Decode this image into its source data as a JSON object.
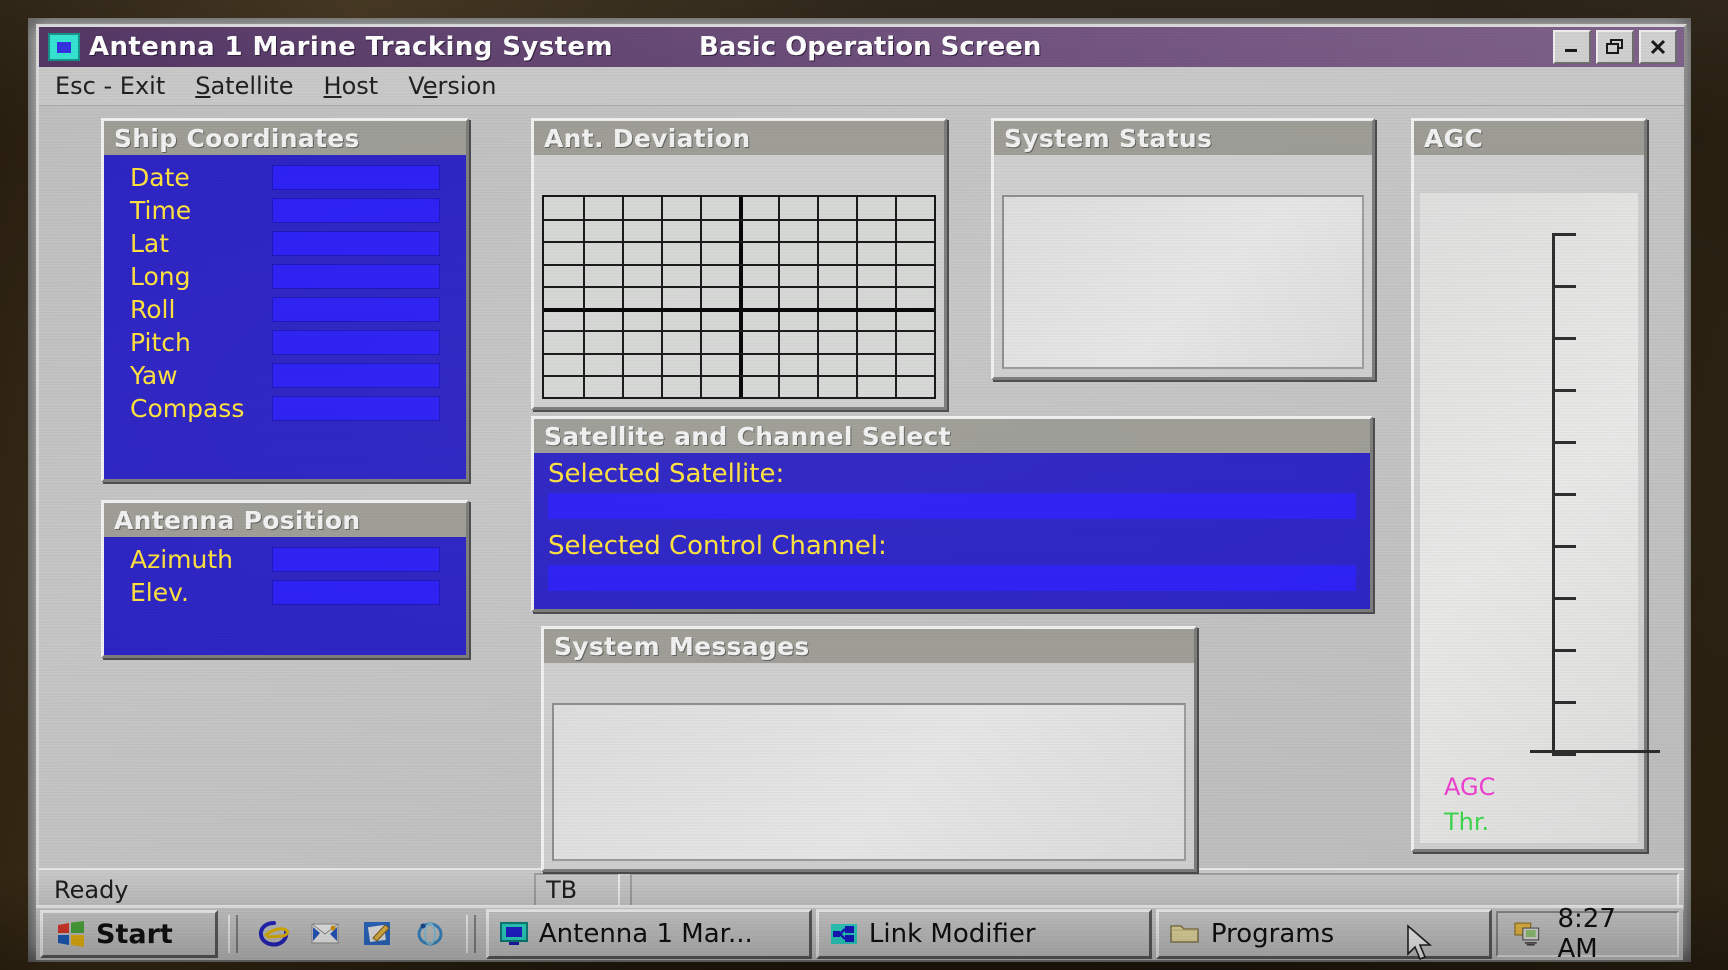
{
  "window": {
    "title": "Antenna 1 Marine Tracking System",
    "subtitle": "Basic Operation Screen",
    "icon": "monitor-icon",
    "controls": {
      "minimize": "–",
      "restore": "❐",
      "close": "✕"
    }
  },
  "menu": {
    "items": [
      {
        "label": "Esc - Exit",
        "accel": ""
      },
      {
        "label": "Satellite",
        "accel": "S"
      },
      {
        "label": "Host",
        "accel": "H"
      },
      {
        "label": "Version",
        "accel": "e"
      }
    ]
  },
  "panels": {
    "ship_coordinates": {
      "caption": "Ship Coordinates",
      "fields": [
        {
          "label": "Date",
          "value": ""
        },
        {
          "label": "Time",
          "value": ""
        },
        {
          "label": "Lat",
          "value": ""
        },
        {
          "label": "Long",
          "value": ""
        },
        {
          "label": "Roll",
          "value": ""
        },
        {
          "label": "Pitch",
          "value": ""
        },
        {
          "label": "Yaw",
          "value": ""
        },
        {
          "label": "Compass",
          "value": ""
        }
      ]
    },
    "antenna_position": {
      "caption": "Antenna Position",
      "fields": [
        {
          "label": "Azimuth",
          "value": ""
        },
        {
          "label": "Elev.",
          "value": ""
        }
      ]
    },
    "ant_deviation": {
      "caption": "Ant. Deviation",
      "grid": {
        "columns": 10,
        "rows": 9,
        "major_col": 5,
        "major_row": 5
      }
    },
    "system_status": {
      "caption": "System Status",
      "content": ""
    },
    "satellite_channel": {
      "caption": "Satellite and Channel Select",
      "satellite_label": "Selected Satellite:",
      "satellite_value": "",
      "channel_label": "Selected Control Channel:",
      "channel_value": ""
    },
    "system_messages": {
      "caption": "System Messages",
      "content": ""
    },
    "agc": {
      "caption": "AGC",
      "legend": [
        {
          "label": "AGC",
          "color": "#ee3fd0"
        },
        {
          "label": "Thr.",
          "color": "#3fd44f"
        }
      ],
      "tick_count": 10
    }
  },
  "statusbar": {
    "message": "Ready",
    "indicator": "TB",
    "extra": ""
  },
  "taskbar": {
    "start_label": "Start",
    "quick_launch": [
      {
        "name": "internet-explorer-icon"
      },
      {
        "name": "outlook-express-icon"
      },
      {
        "name": "notepad-icon"
      },
      {
        "name": "channels-icon"
      }
    ],
    "buttons": [
      {
        "label": "Antenna 1 Mar...",
        "icon": "monitor-icon",
        "active": true
      },
      {
        "label": "Link Modifier",
        "icon": "link-icon",
        "active": false
      },
      {
        "label": "Programs",
        "icon": "folder-icon",
        "active": false
      }
    ],
    "tray_icon": "network-icon",
    "clock": "8:27 AM"
  }
}
